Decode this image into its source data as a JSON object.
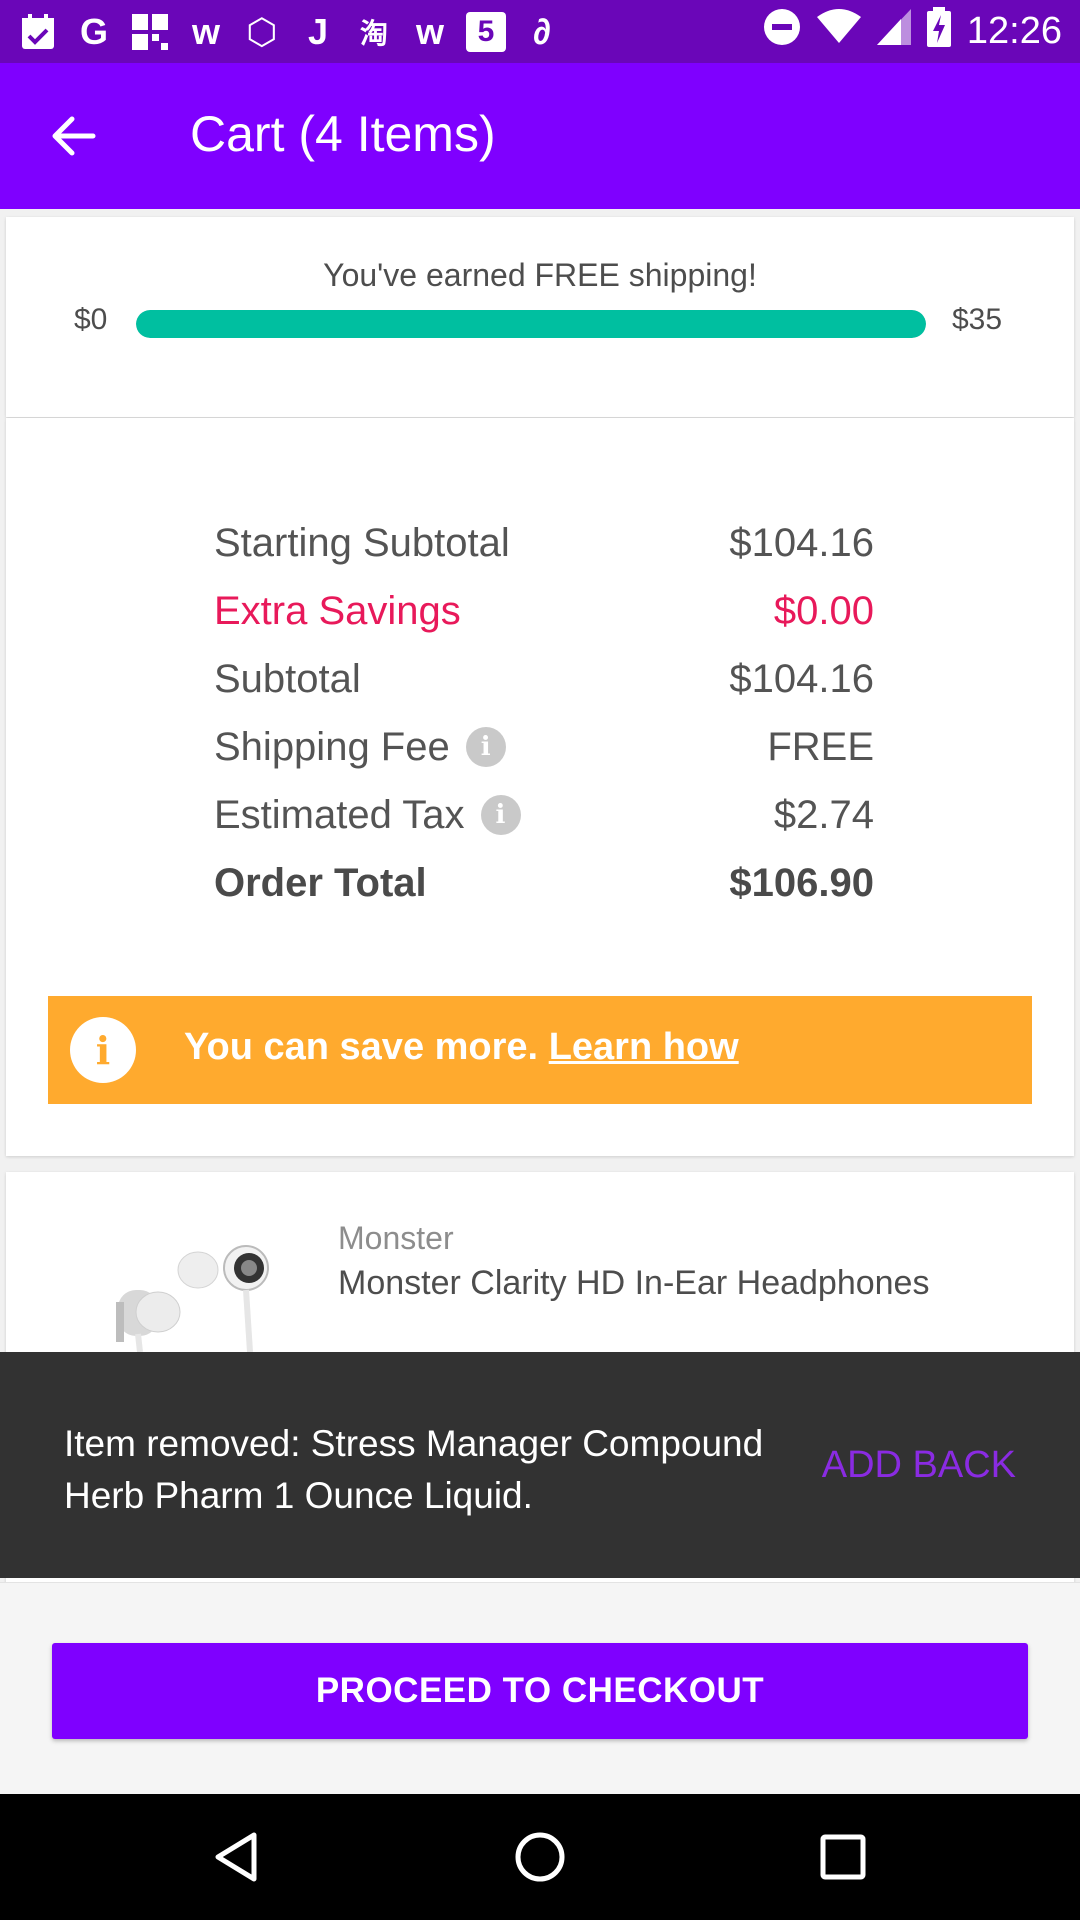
{
  "status_bar": {
    "time": "12:26",
    "notification_icons": [
      "calendar-icon",
      "google-icon",
      "grid-app-icon",
      "w-app-icon",
      "cube-app-icon",
      "j-app-icon",
      "taobao-icon",
      "w-app-icon",
      "html5-icon",
      "link-app-icon"
    ],
    "glyphs": [
      "▦",
      "G",
      "▦",
      "w",
      "⬡",
      "J",
      "淘",
      "w",
      "5",
      "∂"
    ]
  },
  "app_bar": {
    "title": "Cart (4 Items)"
  },
  "shipping": {
    "message": "You've earned FREE shipping!",
    "min_label": "$0",
    "max_label": "$35",
    "progress_fraction": 1.0,
    "bar_color": "#00bfa0"
  },
  "summary": {
    "rows": [
      {
        "label": "Starting Subtotal",
        "value": "$104.16"
      },
      {
        "label": "Extra Savings",
        "value": "$0.00"
      },
      {
        "label": "Subtotal",
        "value": "$104.16"
      },
      {
        "label": "Shipping Fee",
        "value": "FREE"
      },
      {
        "label": "Estimated Tax",
        "value": "$2.74"
      },
      {
        "label": "Order Total",
        "value": "$106.90"
      }
    ],
    "info_glyph": "i",
    "savings_color": "#e8195a"
  },
  "save_banner": {
    "text": "You can save more.",
    "link": "Learn how",
    "icon_glyph": "i",
    "color": "#ffaa2e"
  },
  "item": {
    "brand": "Monster",
    "name": "Monster Clarity HD In-Ear Headphones"
  },
  "snackbar": {
    "message": "Item removed: Stress Manager Compound Herb Pharm 1 Ounce Liquid.",
    "action": "ADD BACK"
  },
  "checkout": {
    "button_label": "PROCEED TO CHECKOUT",
    "color": "#7f00ff"
  },
  "colors": {
    "status_bar": "#6a06b8",
    "app_bar": "#7f00ff"
  }
}
